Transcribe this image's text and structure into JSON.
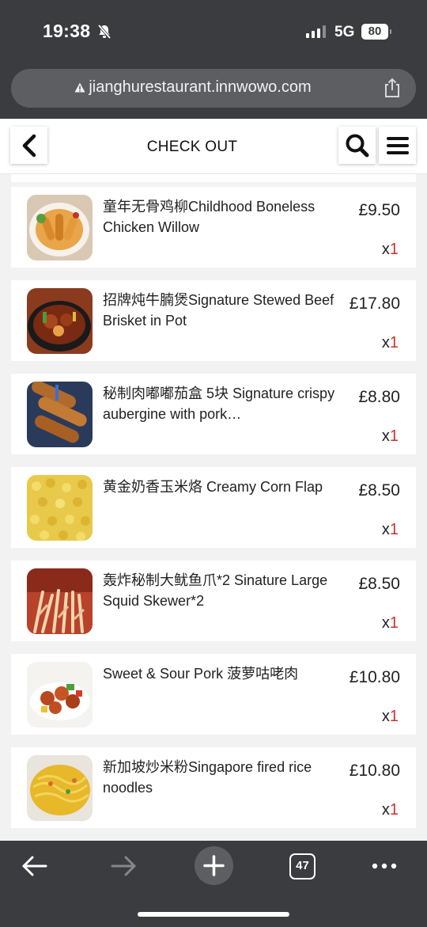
{
  "status_bar": {
    "time": "19:38",
    "network": "5G",
    "battery": "80"
  },
  "browser": {
    "url": "jianghurestaurant.innwowo.com",
    "tab_count": "47"
  },
  "header": {
    "title": "CHECK OUT"
  },
  "cart": {
    "items": [
      {
        "name": "童年无骨鸡柳Childhood Boneless Chicken Willow",
        "price": "£9.50",
        "qty_prefix": "x",
        "qty": "1"
      },
      {
        "name": "招牌炖牛腩煲Signature Stewed Beef Brisket in Pot",
        "price": "£17.80",
        "qty_prefix": "x",
        "qty": "1"
      },
      {
        "name": "秘制肉嘟嘟茄盒 5块 Signature crispy aubergine with pork…",
        "price": "£8.80",
        "qty_prefix": "x",
        "qty": "1"
      },
      {
        "name": "黄金奶香玉米烙 Creamy Corn Flap",
        "price": "£8.50",
        "qty_prefix": "x",
        "qty": "1"
      },
      {
        "name": "轰炸秘制大鱿鱼爪*2 Sinature Large Squid Skewer*2",
        "price": "£8.50",
        "qty_prefix": "x",
        "qty": "1"
      },
      {
        "name": "Sweet & Sour Pork 菠萝咕咾肉",
        "price": "£10.80",
        "qty_prefix": "x",
        "qty": "1"
      },
      {
        "name": "新加坡炒米粉Singapore fired rice noodles",
        "price": "£10.80",
        "qty_prefix": "x",
        "qty": "1"
      }
    ]
  },
  "colors": {
    "chrome": "#3a3c3f",
    "accent_qty": "#d0312d"
  }
}
